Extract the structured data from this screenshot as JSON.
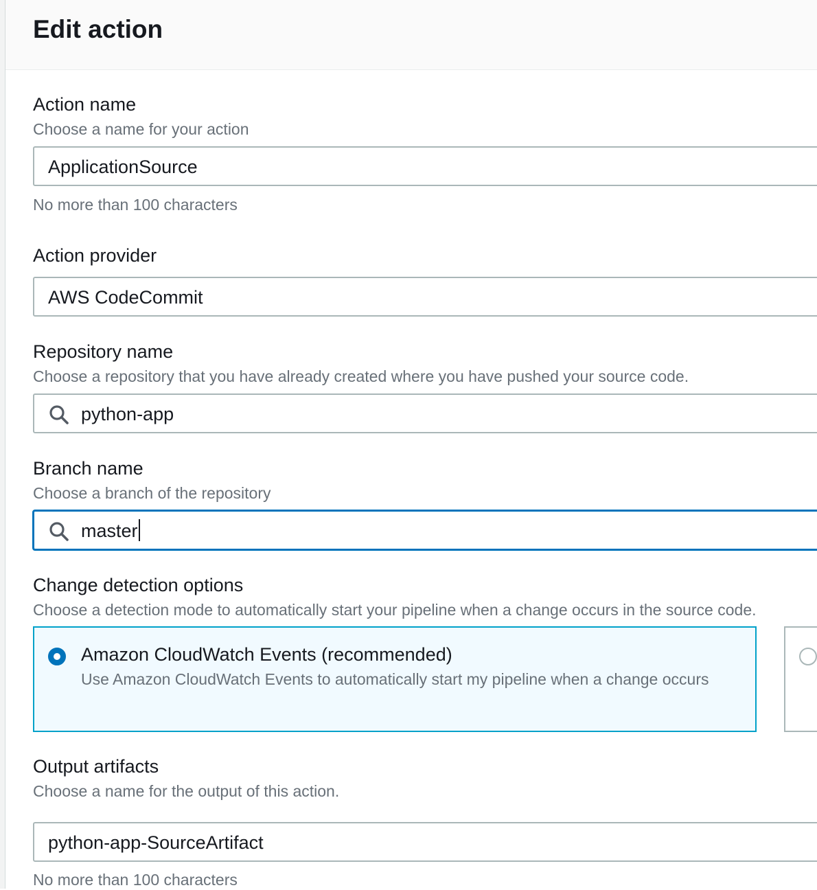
{
  "dialog": {
    "title": "Edit action"
  },
  "action_name": {
    "label": "Action name",
    "description": "Choose a name for your action",
    "value": "ApplicationSource",
    "constraint": "No more than 100 characters"
  },
  "action_provider": {
    "label": "Action provider",
    "value": "AWS CodeCommit"
  },
  "repository_name": {
    "label": "Repository name",
    "description": "Choose a repository that you have already created where you have pushed your source code.",
    "value": "python-app",
    "icon": "search-icon"
  },
  "branch_name": {
    "label": "Branch name",
    "description": "Choose a branch of the repository",
    "value": "master",
    "icon": "search-icon"
  },
  "change_detection": {
    "label": "Change detection options",
    "description": "Choose a detection mode to automatically start your pipeline when a change occurs in the source code.",
    "options": [
      {
        "title": "Amazon CloudWatch Events (recommended)",
        "description": "Use Amazon CloudWatch Events to automatically start my pipeline when a change occurs",
        "selected": true
      },
      {
        "title": "",
        "description": "",
        "selected": false
      }
    ]
  },
  "output_artifacts": {
    "label": "Output artifacts",
    "description": "Choose a name for the output of this action.",
    "value": "python-app-SourceArtifact",
    "constraint": "No more than 100 characters"
  },
  "colors": {
    "accent": "#0073bb",
    "selected_card_bg": "#f1faff",
    "selected_card_border": "#00a1c9",
    "muted_text": "#687078"
  }
}
